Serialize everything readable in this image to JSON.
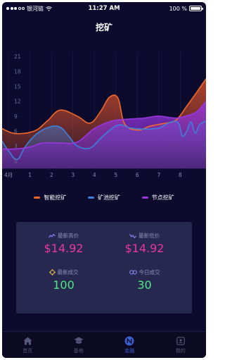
{
  "status_bar": {
    "carrier": "银河链",
    "time": "11:27 AM",
    "battery": "100 %"
  },
  "nav": {
    "title": "挖矿"
  },
  "chart_data": {
    "type": "area",
    "x_tick_labels": [
      "4月",
      "1",
      "2",
      "3",
      "4",
      "5",
      "6",
      "7",
      "8"
    ],
    "x_ticks": [
      0,
      1,
      2,
      3,
      4,
      5,
      6,
      7,
      8
    ],
    "xlim": [
      -0.3,
      9.2
    ],
    "y_tick_labels": [
      "0",
      "3",
      "6",
      "9",
      "12",
      "15",
      "18",
      "21"
    ],
    "y_ticks": [
      0,
      3,
      6,
      9,
      12,
      15,
      18,
      21
    ],
    "ylim": [
      -1.5,
      22
    ],
    "series": [
      {
        "name": "智能挖矿",
        "color": "#f0692a",
        "points": [
          [
            -0.3,
            6.5
          ],
          [
            0.3,
            5.5
          ],
          [
            1.2,
            6
          ],
          [
            1.8,
            8
          ],
          [
            2.4,
            10.2
          ],
          [
            3.2,
            9
          ],
          [
            3.8,
            7.6
          ],
          [
            4.3,
            10
          ],
          [
            4.7,
            12.8
          ],
          [
            5.1,
            12.6
          ],
          [
            5.4,
            7.5
          ],
          [
            6,
            6.2
          ],
          [
            6.6,
            7
          ],
          [
            7.2,
            7.5
          ],
          [
            7.8,
            8.2
          ],
          [
            8.3,
            11
          ],
          [
            8.8,
            14
          ],
          [
            9.2,
            16.5
          ]
        ]
      },
      {
        "name": "矿池挖矿",
        "color": "#3f7fdc",
        "points": [
          [
            -0.3,
            4
          ],
          [
            0,
            2
          ],
          [
            0.4,
            0.3
          ],
          [
            0.8,
            3
          ],
          [
            1.3,
            5.4
          ],
          [
            1.9,
            6.8
          ],
          [
            2.4,
            6.8
          ],
          [
            2.8,
            5
          ],
          [
            3.2,
            3
          ],
          [
            3.8,
            2.6
          ],
          [
            4.4,
            5
          ],
          [
            5.1,
            7.2
          ],
          [
            5.7,
            6.6
          ],
          [
            6.4,
            6.4
          ],
          [
            7,
            6.6
          ],
          [
            7.5,
            7.7
          ],
          [
            7.9,
            7.7
          ],
          [
            8.1,
            5
          ],
          [
            8.3,
            6
          ],
          [
            8.5,
            7.8
          ],
          [
            8.7,
            5.6
          ],
          [
            8.9,
            7.3
          ],
          [
            9.2,
            8
          ]
        ]
      },
      {
        "name": "节点挖矿",
        "color": "#9a36e0",
        "points": [
          [
            -0.3,
            2.4
          ],
          [
            0.3,
            2.4
          ],
          [
            1,
            2.8
          ],
          [
            1.6,
            3.6
          ],
          [
            2.4,
            3.6
          ],
          [
            3.2,
            3.8
          ],
          [
            4,
            6.5
          ],
          [
            4.8,
            8
          ],
          [
            5.6,
            8.4
          ],
          [
            6.3,
            8.6
          ],
          [
            7,
            9
          ],
          [
            7.8,
            8.6
          ],
          [
            8.4,
            9.2
          ],
          [
            8.8,
            10
          ],
          [
            9.2,
            12
          ]
        ]
      }
    ]
  },
  "legend": [
    {
      "label": "智能挖矿",
      "color": "#f0692a"
    },
    {
      "label": "矿池挖矿",
      "color": "#3f7fdc"
    },
    {
      "label": "节点挖矿",
      "color": "#9a36e0"
    }
  ],
  "stats": {
    "highest": {
      "label": "最新高价",
      "value": "$14.92"
    },
    "lowest": {
      "label": "最新低价",
      "value": "$14.92"
    },
    "latest_trades": {
      "label": "最新成交",
      "value": "100"
    },
    "today_trades": {
      "label": "今日成交",
      "value": "30"
    }
  },
  "tabs": [
    {
      "label": "首页",
      "icon": "home-icon"
    },
    {
      "label": "基地",
      "icon": "graduation-cap-icon"
    },
    {
      "label": "金融",
      "icon": "finance-icon",
      "active": true
    },
    {
      "label": "我的",
      "icon": "profile-icon"
    }
  ]
}
